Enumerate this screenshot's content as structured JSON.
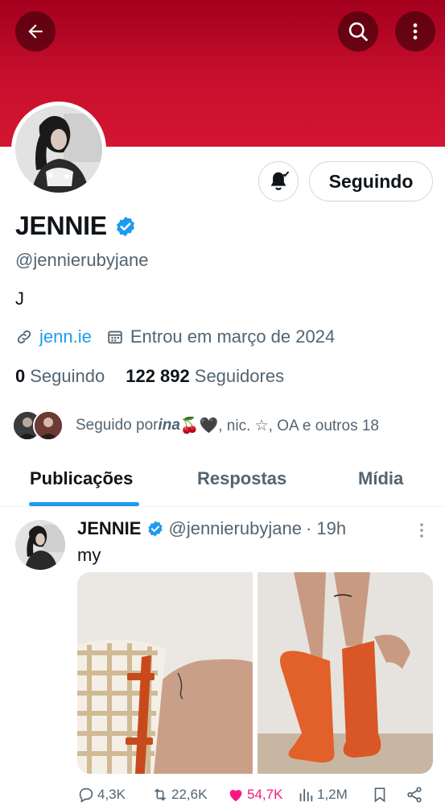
{
  "profile": {
    "name": "JENNIE",
    "handle": "@jennierubyjane",
    "bio": "J",
    "link": "jenn.ie",
    "joined": "Entrou em março de 2024",
    "following_count": "0",
    "following_label": "Seguindo",
    "followers_count": "122 892",
    "followers_label": "Seguidores",
    "followed_by_prefix": "Seguido por ",
    "followed_by_name": "ina",
    "followed_by_rest": " 🍒🖤, nic. ☆, OA e outros 18"
  },
  "header": {
    "follow_button_label": "Seguindo",
    "back_icon": "arrow-left-icon",
    "search_icon": "search-icon",
    "more_icon": "more-vertical-icon"
  },
  "tabs": [
    {
      "label": "Publicações",
      "active": true
    },
    {
      "label": "Respostas",
      "active": false
    },
    {
      "label": "Mídia",
      "active": false
    }
  ],
  "post": {
    "author": "JENNIE",
    "handle": "@jennierubyjane",
    "time": "· 19h",
    "text": "my",
    "replies": "4,3K",
    "reposts": "22,6K",
    "likes": "54,7K",
    "views": "1,2M"
  },
  "colors": {
    "banner": "#c8102e",
    "accent": "#1d9bf0",
    "like": "#f91880",
    "secondary_text": "#536471"
  }
}
